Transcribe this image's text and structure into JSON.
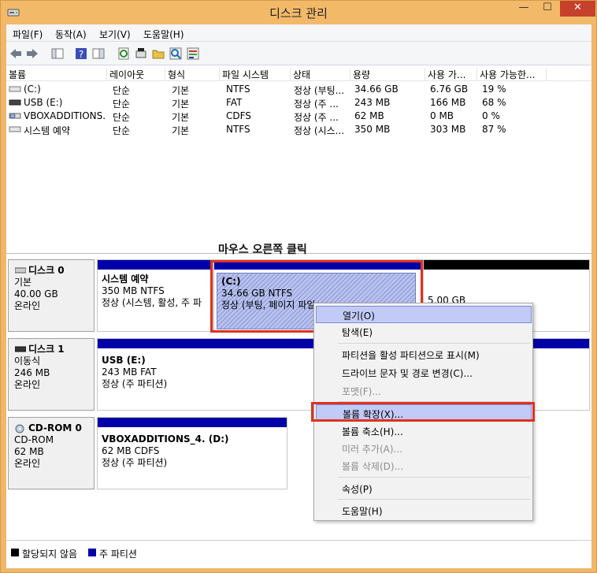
{
  "window": {
    "title": "디스크 관리",
    "minimize": "—",
    "maximize": "☐",
    "close": "✕"
  },
  "menu": [
    "파일(F)",
    "동작(A)",
    "보기(V)",
    "도움말(H)"
  ],
  "toolbar_icons": [
    "back-arrow-icon",
    "forward-arrow-icon",
    "console-tree-icon",
    "help-icon",
    "show-hide-icon",
    "refresh-icon",
    "rescan-icon",
    "open-folder-icon",
    "search-icon",
    "properties-icon"
  ],
  "columns": [
    "볼륨",
    "레이아웃",
    "형식",
    "파일 시스템",
    "상태",
    "용량",
    "사용 가...",
    "사용 가능한..."
  ],
  "volumes": [
    {
      "name": "(C:)",
      "layout": "단순",
      "type": "기본",
      "fs": "NTFS",
      "status": "정상 (부팅...",
      "capacity": "34.66 GB",
      "free": "6.76 GB",
      "pct": "19 %"
    },
    {
      "name": "USB (E:)",
      "layout": "단순",
      "type": "기본",
      "fs": "FAT",
      "status": "정상 (주 ...",
      "capacity": "243 MB",
      "free": "166 MB",
      "pct": "68 %"
    },
    {
      "name": "VBOXADDITIONS...",
      "layout": "단순",
      "type": "기본",
      "fs": "CDFS",
      "status": "정상 (주 ...",
      "capacity": "62 MB",
      "free": "0 MB",
      "pct": "0 %"
    },
    {
      "name": "시스템 예약",
      "layout": "단순",
      "type": "기본",
      "fs": "NTFS",
      "status": "정상 (시스...",
      "capacity": "350 MB",
      "free": "303 MB",
      "pct": "87 %"
    }
  ],
  "annotation": "마우스 오른쪽 클릭",
  "disks": [
    {
      "name": "디스크 0",
      "kind": "기본",
      "size": "40.00 GB",
      "state": "온라인"
    },
    {
      "name": "디스크 1",
      "kind": "이동식",
      "size": "246 MB",
      "state": "온라인"
    },
    {
      "name": "CD-ROM 0",
      "kind": "CD-ROM",
      "size": "62 MB",
      "state": "온라인"
    }
  ],
  "partitions": {
    "sys": {
      "title": "시스템 예약",
      "size": "350 MB NTFS",
      "status": "정상 (시스템, 활성, 주 파"
    },
    "c": {
      "title": "(C:)",
      "size": "34.66 GB NTFS",
      "status": "정상 (부팅, 페이지 파일"
    },
    "unalloc": {
      "size": "5.00 GB"
    },
    "usb": {
      "title": "USB  (E:)",
      "size": "243 MB FAT",
      "status": "정상 (주 파티션)"
    },
    "cd": {
      "title": "VBOXADDITIONS_4.  (D:)",
      "size": "62 MB CDFS",
      "status": "정상 (주 파티션)"
    }
  },
  "context_menu": {
    "open": "열기(O)",
    "explore": "탐색(E)",
    "mark_active": "파티션을 활성 파티션으로 표시(M)",
    "change_letter": "드라이브 문자 및 경로 변경(C)...",
    "format": "포맷(F)...",
    "extend": "볼륨 확장(X)...",
    "shrink": "볼륨 축소(H)...",
    "add_mirror": "미러 추가(A)...",
    "delete": "볼륨 삭제(D)...",
    "properties": "속성(P)",
    "help": "도움말(H)"
  },
  "legend": {
    "unallocated": "할당되지 않음",
    "primary": "주 파티션"
  },
  "colors": {
    "primary": "#0000a8",
    "unallocated": "#000000",
    "highlight": "#e0311f",
    "titlebar": "#f2b969"
  }
}
